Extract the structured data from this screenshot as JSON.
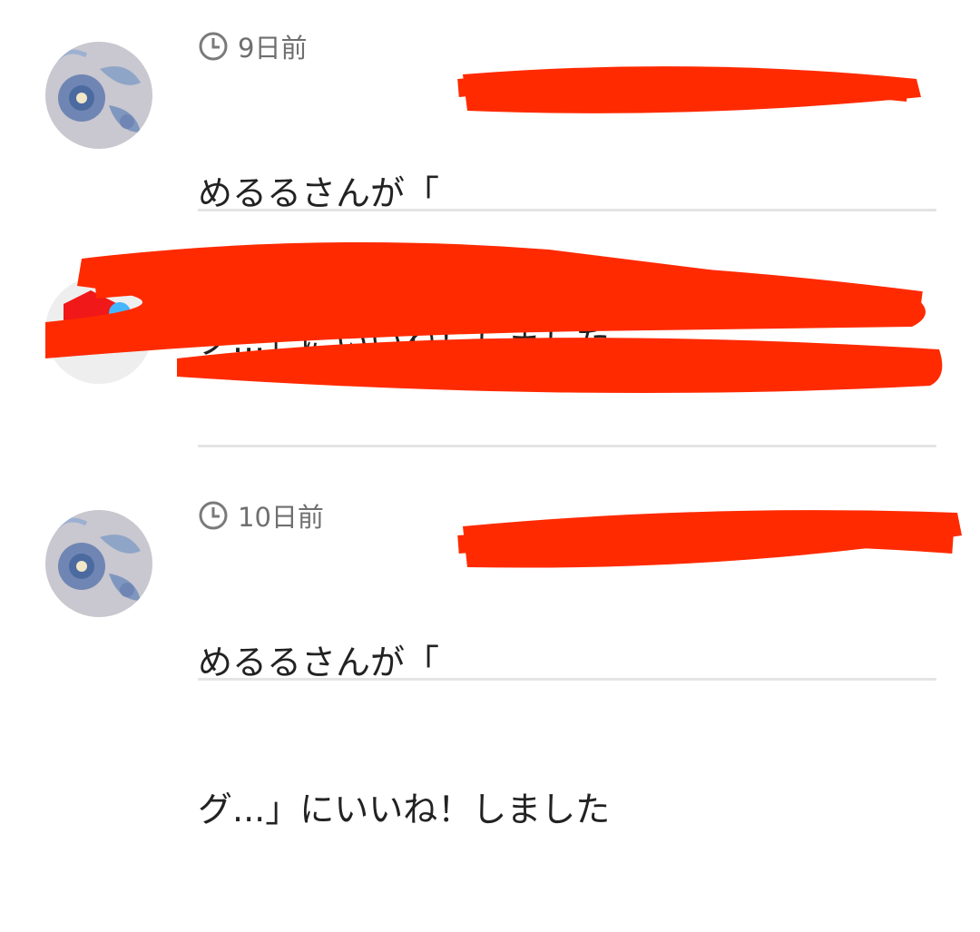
{
  "notifications": [
    {
      "time": "9日前",
      "message_line1": "めるるさんが「",
      "message_line2": "グ...」にいいね！しました"
    },
    {
      "time": "",
      "message_line1": "",
      "message_line2": ""
    },
    {
      "time": "10日前",
      "message_line1": "めるるさんが「",
      "message_line2": "グ...」にいいね！しました"
    }
  ],
  "colors": {
    "redaction": "#ff2a00",
    "divider": "#e4e4e4",
    "time_text": "#6f6f6f",
    "message_text": "#222222"
  },
  "icons": {
    "time": "clock-icon"
  }
}
